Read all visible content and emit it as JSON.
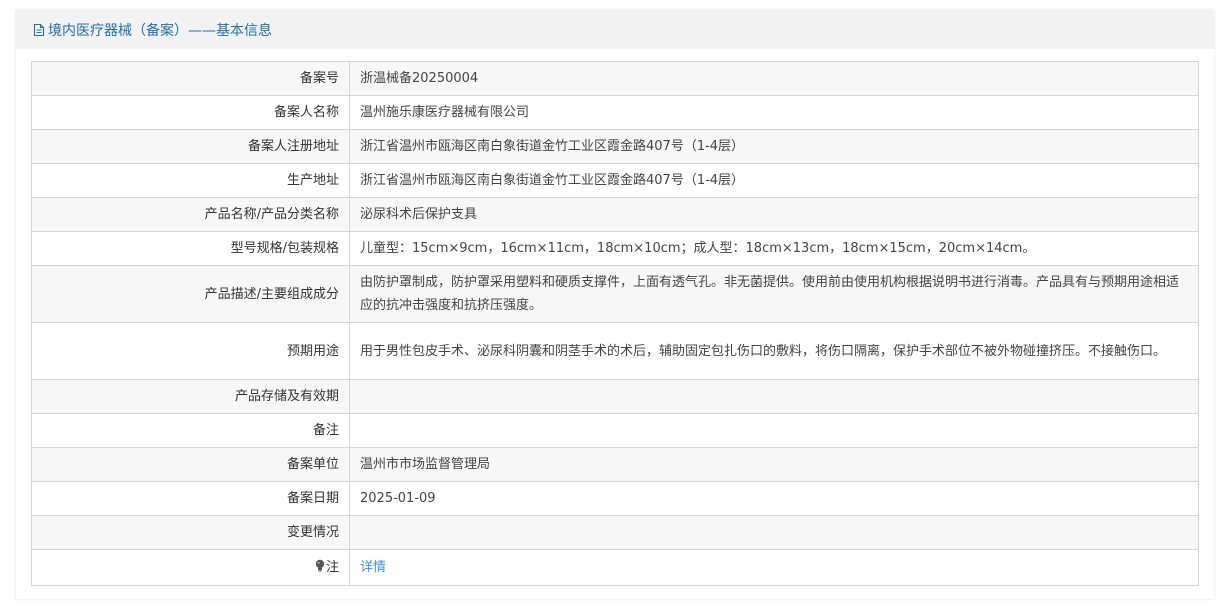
{
  "header": {
    "title": "境内医疗器械（备案）——基本信息",
    "icon": "document-icon"
  },
  "colors": {
    "header_text": "#1f6fb2",
    "link": "#3a8ee6",
    "row_odd": "#f7f7f7",
    "border": "#d4d4d4"
  },
  "rows": [
    {
      "label": "备案号",
      "value": "浙温械备20250004"
    },
    {
      "label": "备案人名称",
      "value": "温州施乐康医疗器械有限公司"
    },
    {
      "label": "备案人注册地址",
      "value": "浙江省温州市瓯海区南白象街道金竹工业区霞金路407号（1-4层）"
    },
    {
      "label": "生产地址",
      "value": "浙江省温州市瓯海区南白象街道金竹工业区霞金路407号（1-4层）"
    },
    {
      "label": "产品名称/产品分类名称",
      "value": "泌尿科术后保护支具"
    },
    {
      "label": "型号规格/包装规格",
      "value": "儿童型：15cm×9cm，16cm×11cm，18cm×10cm；成人型：18cm×13cm，18cm×15cm，20cm×14cm。"
    },
    {
      "label": "产品描述/主要组成成分",
      "value": "由防护罩制成，防护罩采用塑料和硬质支撑件，上面有透气孔。非无菌提供。使用前由使用机构根据说明书进行消毒。产品具有与预期用途相适应的抗冲击强度和抗挤压强度。"
    },
    {
      "label": "预期用途",
      "value": "用于男性包皮手术、泌尿科阴囊和阴茎手术的术后，辅助固定包扎伤口的敷料，将伤口隔离，保护手术部位不被外物碰撞挤压。不接触伤口。"
    },
    {
      "label": "产品存储及有效期",
      "value": ""
    },
    {
      "label": "备注",
      "value": ""
    },
    {
      "label": "备案单位",
      "value": "温州市市场监督管理局"
    },
    {
      "label": "备案日期",
      "value": "2025-01-09"
    },
    {
      "label": "变更情况",
      "value": ""
    }
  ],
  "note_row": {
    "icon": "lightbulb-icon",
    "label": "注",
    "link_text": "详情"
  }
}
